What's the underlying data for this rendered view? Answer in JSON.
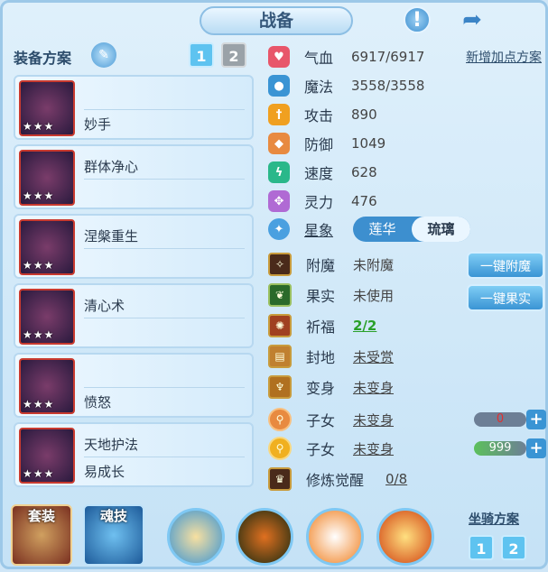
{
  "title": "战备",
  "left": {
    "scheme_label": "装备方案",
    "scheme_buttons": [
      "1",
      "2"
    ],
    "skills": [
      {
        "name": "妙手",
        "stars": "★★★"
      },
      {
        "name": "群体净心",
        "stars": "★★★"
      },
      {
        "name": "涅槃重生",
        "stars": "★★★"
      },
      {
        "name": "清心术",
        "stars": "★★★"
      },
      {
        "name": "愤怒",
        "stars": "★★★"
      },
      {
        "name": "天地护法",
        "name2": "易成长",
        "stars": "★★★"
      }
    ]
  },
  "stats": [
    {
      "label": "气血",
      "value": "6917/6917",
      "icon": "heart-icon",
      "color": "#e8566a"
    },
    {
      "label": "魔法",
      "value": "3558/3558",
      "icon": "drop-icon",
      "color": "#3a94d4"
    },
    {
      "label": "攻击",
      "value": "890",
      "icon": "sword-icon",
      "color": "#f0a020"
    },
    {
      "label": "防御",
      "value": "1049",
      "icon": "shield-icon",
      "color": "#e88a40"
    },
    {
      "label": "速度",
      "value": "628",
      "icon": "speed-icon",
      "color": "#2ab88a"
    },
    {
      "label": "灵力",
      "value": "476",
      "icon": "spirit-icon",
      "color": "#b06ad4"
    }
  ],
  "add_points_label": "新增加点方案",
  "xingxiang": {
    "label": "星象",
    "options": [
      "莲华",
      "琉璃"
    ],
    "selected": "琉璃"
  },
  "rows": [
    {
      "label": "附魔",
      "value": "未附魔"
    },
    {
      "label": "果实",
      "value": "未使用"
    },
    {
      "label": "祈福",
      "value": "2/2"
    },
    {
      "label": "封地",
      "value": "未受赏"
    },
    {
      "label": "变身",
      "value": "未变身"
    },
    {
      "label": "子女",
      "value": "未变身",
      "bar_value": "0"
    },
    {
      "label": "子女",
      "value": "未变身",
      "bar_value": "999"
    },
    {
      "label": "修炼觉醒",
      "value": "0/8"
    }
  ],
  "actions": {
    "enchant": "一键附魔",
    "fruit": "一键果实"
  },
  "bottom": {
    "equip_label": "套装",
    "soul_label": "魂技",
    "mount_label": "坐骑方案",
    "mount_buttons": [
      "1",
      "2"
    ]
  }
}
